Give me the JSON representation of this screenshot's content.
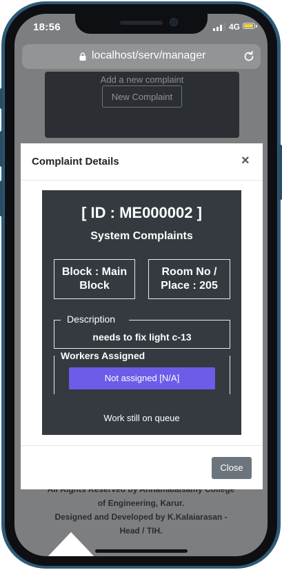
{
  "status_bar": {
    "time": "18:56",
    "network": "4G"
  },
  "browser": {
    "url": "localhost/serv/manager"
  },
  "background": {
    "hint": "Add a new complaint",
    "new_button": "New Complaint"
  },
  "modal": {
    "title": "Complaint Details",
    "close_x": "×",
    "id_label": "[ ID : ME000002 ]",
    "category": "System Complaints",
    "block_line1": "Block : Main",
    "block_line2": "Block",
    "room_line1": "Room No /",
    "room_line2": "Place : 205",
    "description_legend": "Description",
    "description": "needs to fix light c-13",
    "workers_legend": "Workers Assigned",
    "workers_value": "Not assigned [N/A]",
    "status": "Work still on queue",
    "close_button": "Close"
  },
  "footer": {
    "line1": "All Rights Reserved by Annamalaisamy College",
    "line2": "of Engineering, Karur.",
    "line3": "Designed and Developed by K.Kalaiarasan -",
    "line4": "Head / TIH."
  },
  "colors": {
    "accent": "#6c5ce7",
    "panel": "#343a40",
    "frame": "#2f5a78"
  }
}
